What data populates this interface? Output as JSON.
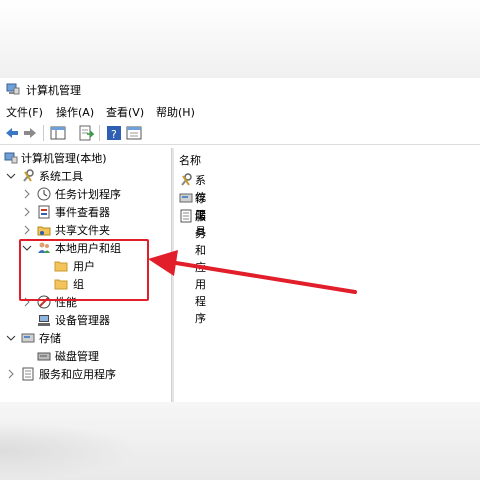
{
  "window": {
    "title": "计算机管理"
  },
  "menu": [
    "文件(F)",
    "操作(A)",
    "查看(V)",
    "帮助(H)"
  ],
  "toolbar": [
    "back-icon",
    "forward-icon",
    "show-hide-console-tree-icon",
    "export-list-icon",
    "help-icon",
    "properties-icon"
  ],
  "tree": {
    "root": "计算机管理(本地)",
    "system_tools": "系统工具",
    "task_scheduler": "任务计划程序",
    "event_viewer": "事件查看器",
    "shared_folders": "共享文件夹",
    "local_users_groups": "本地用户和组",
    "users": "用户",
    "groups": "组",
    "performance": "性能",
    "device_manager": "设备管理器",
    "storage": "存储",
    "disk_management": "磁盘管理",
    "services_apps": "服务和应用程序"
  },
  "right_pane": {
    "column_header": "名称",
    "items": [
      "系统工具",
      "存储",
      "服务和应用程序"
    ]
  },
  "colors": {
    "annotation": "#e11e2a",
    "folder": "#f2c45a"
  }
}
